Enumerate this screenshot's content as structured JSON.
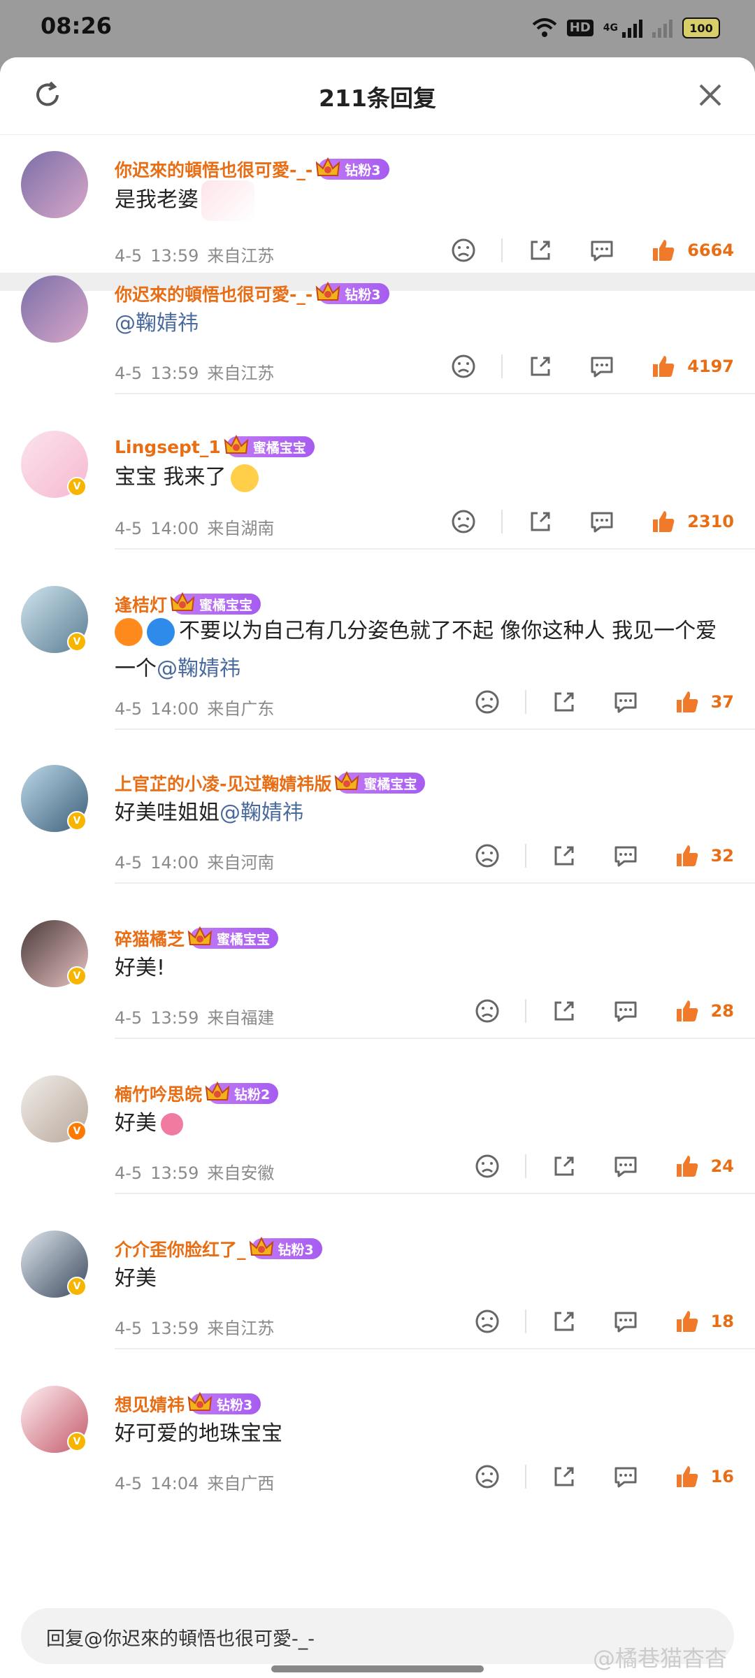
{
  "status_bar": {
    "time": "08:26",
    "hd": "HD",
    "net": "4G",
    "battery": "100"
  },
  "header": {
    "title": "211条回复"
  },
  "comments": [
    {
      "user": "你迟來的頓悟也很可愛-_-",
      "badge": "钻粉3",
      "text": "是我老婆",
      "time": "4-5",
      "clock": "13:59",
      "loc": "来自江苏",
      "likes": "6664"
    },
    {
      "user": "你迟來的頓悟也很可愛-_-",
      "badge": "钻粉3",
      "mention": "@鞠婧祎",
      "time": "4-5",
      "clock": "13:59",
      "loc": "来自江苏",
      "likes": "4197"
    },
    {
      "user": "Lingsept_1",
      "badge": "蜜橘宝宝",
      "text": "宝宝  我来了",
      "time": "4-5",
      "clock": "14:00",
      "loc": "来自湖南",
      "likes": "2310"
    },
    {
      "user": "逢桔灯",
      "badge": "蜜橘宝宝",
      "text": "不要以为自己有几分姿色就了不起  像你这种人  我见一个爱一个",
      "mention": "@鞠婧祎",
      "time": "4-5",
      "clock": "14:00",
      "loc": "来自广东",
      "likes": "37"
    },
    {
      "user": "上官芷的小凌-见过鞠婧祎版",
      "badge": "蜜橘宝宝",
      "text": "好美哇姐姐",
      "mention": "@鞠婧祎",
      "time": "4-5",
      "clock": "14:00",
      "loc": "来自河南",
      "likes": "32"
    },
    {
      "user": "碎猫橘芝",
      "badge": "蜜橘宝宝",
      "text": "好美!",
      "time": "4-5",
      "clock": "13:59",
      "loc": "来自福建",
      "likes": "28"
    },
    {
      "user": "楠竹吟思皖",
      "badge": "钻粉2",
      "text": "好美",
      "time": "4-5",
      "clock": "13:59",
      "loc": "来自安徽",
      "likes": "24"
    },
    {
      "user": "介介歪你脸红了_",
      "badge": "钻粉3",
      "text": "好美",
      "time": "4-5",
      "clock": "13:59",
      "loc": "来自江苏",
      "likes": "18"
    },
    {
      "user": "想见婧祎",
      "badge": "钻粉3",
      "text": "好可爱的地珠宝宝",
      "time": "4-5",
      "clock": "14:04",
      "loc": "来自广西",
      "likes": "16"
    }
  ],
  "reply_bar": {
    "placeholder": "回复@你迟來的頓悟也很可愛-_-"
  },
  "watermark": "@橘巷猫杳杳",
  "colors": {
    "accent": "#e86e16",
    "mention": "#4a6a9e",
    "badge": "#b06cf2"
  }
}
